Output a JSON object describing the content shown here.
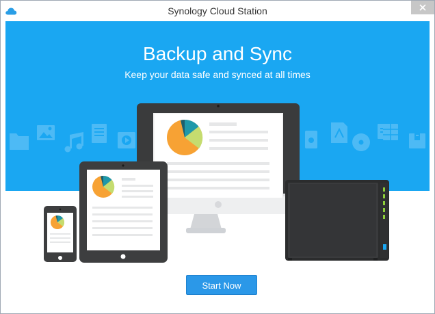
{
  "window": {
    "title": "Synology Cloud Station",
    "app_icon": "cloud-icon",
    "close_icon": "close-icon"
  },
  "hero": {
    "title": "Backup and Sync",
    "subtitle": "Keep your data safe and synced at all times",
    "background_color": "#1aa7f2"
  },
  "illustration": {
    "background_icons_left": [
      "folder-icon",
      "image-icon",
      "music-icon",
      "document-icon",
      "video-icon"
    ],
    "background_icons_right": [
      "ebook-icon",
      "pdf-icon",
      "disc-icon",
      "presentation-icon",
      "spreadsheet-icon",
      "archive-icon"
    ],
    "devices": [
      "monitor",
      "tablet",
      "phone",
      "nas-server"
    ],
    "chart_colors": [
      "#f7a234",
      "#c5dc6f",
      "#1f98a9",
      "#1d5f6d"
    ]
  },
  "actions": {
    "start_label": "Start Now",
    "start_color": "#2b98e8"
  }
}
